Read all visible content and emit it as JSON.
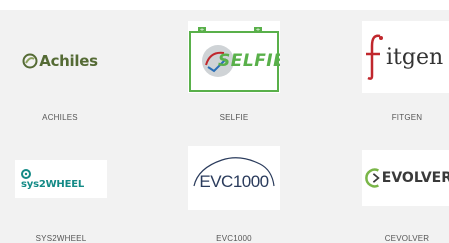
{
  "partners": [
    {
      "name": "ACHILES",
      "logo_text": "Achiles",
      "accent": "#556b35"
    },
    {
      "name": "SELFIE",
      "logo_text": "SELFIE",
      "accent": "#59b04a"
    },
    {
      "name": "FITGEN",
      "logo_text": "itgen",
      "accent": "#c0272d"
    },
    {
      "name": "SYS2WHEEL",
      "logo_text": "sys2WHEEL",
      "accent": "#138a86"
    },
    {
      "name": "EVC1000",
      "logo_text": "EVC1000",
      "accent": "#2a3b5c"
    },
    {
      "name": "CEVOLVER",
      "logo_text": "EVOLVER",
      "accent": "#7ab648"
    }
  ]
}
